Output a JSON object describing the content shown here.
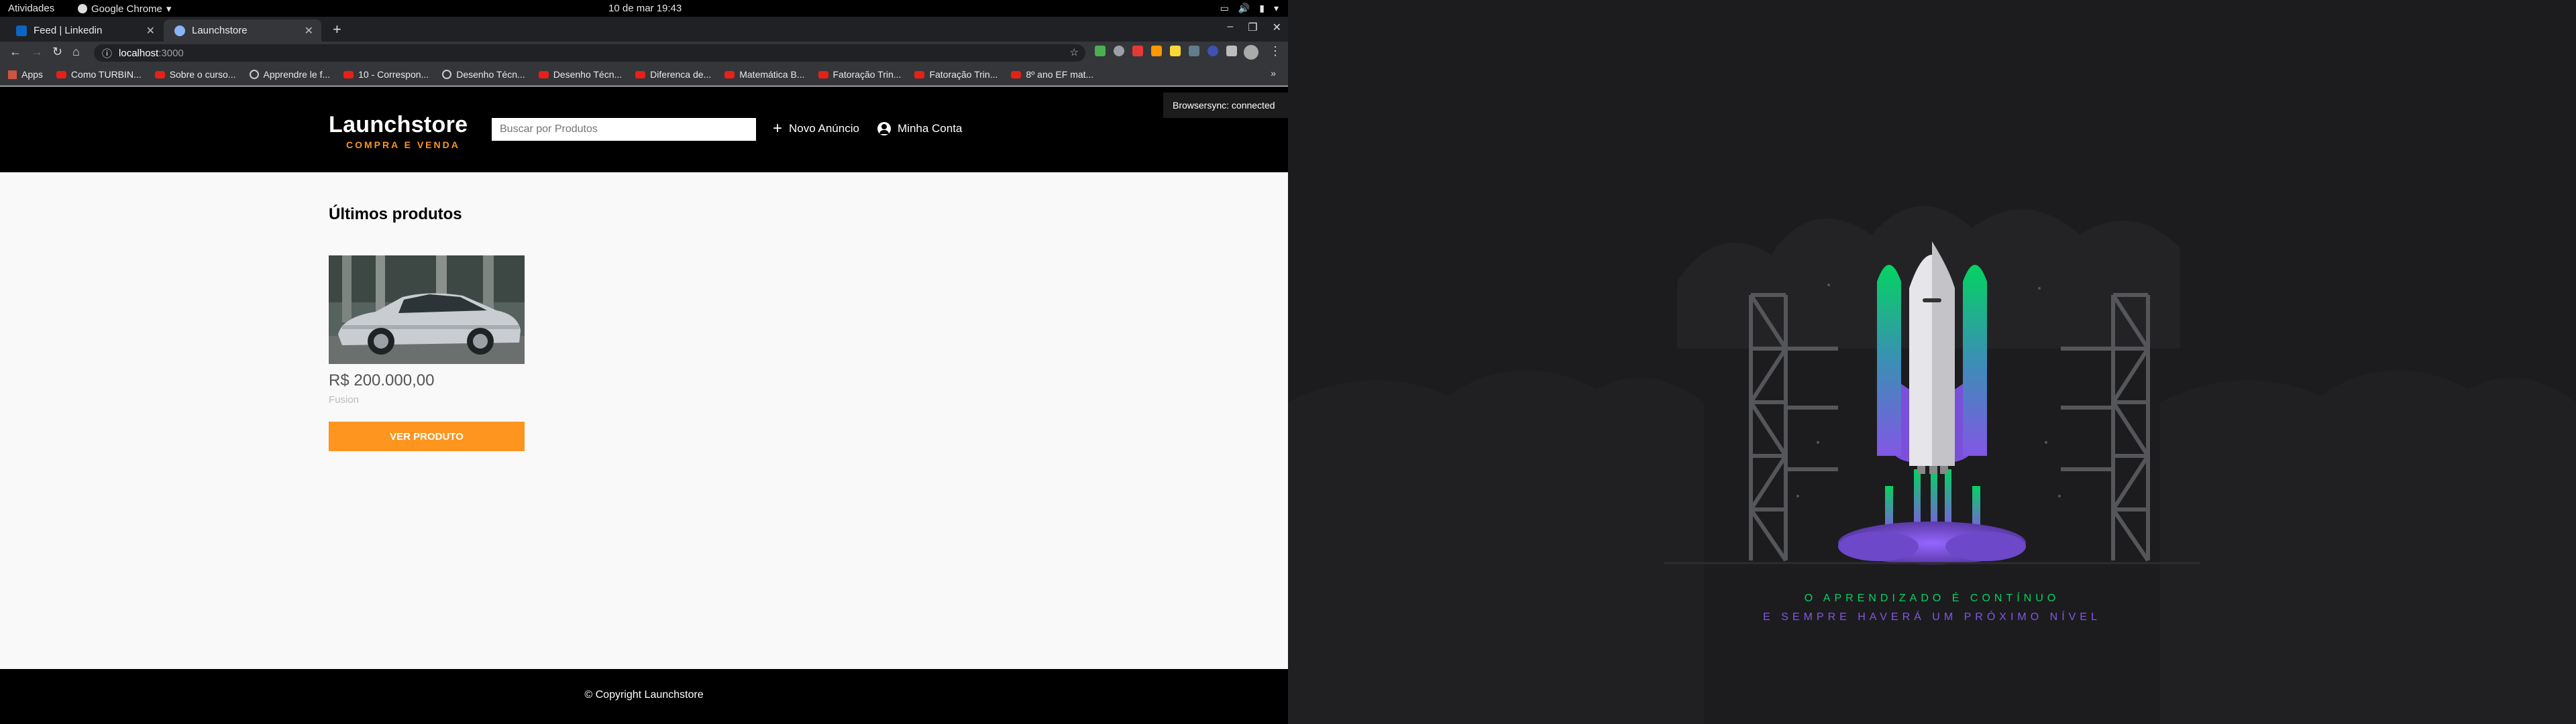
{
  "os_bar": {
    "activities": "Atividades",
    "app_name": "Google Chrome",
    "clock": "10 de mar  19:43"
  },
  "browser": {
    "tabs": [
      {
        "title": "Feed | Linkedin",
        "favicon_color": "#0a66c2"
      },
      {
        "title": "Launchstore",
        "favicon_color": "#8ab4f8"
      }
    ],
    "address": {
      "host": "localhost",
      "port": ":3000"
    },
    "bookmarks": [
      {
        "label": "Apps",
        "icon": "apps-grid-icon"
      },
      {
        "label": "Como TURBIN...",
        "icon": "youtube-icon"
      },
      {
        "label": "Sobre o curso...",
        "icon": "youtube-icon"
      },
      {
        "label": "Apprendre le f...",
        "icon": "globe-icon"
      },
      {
        "label": "10 - Correspon...",
        "icon": "youtube-icon"
      },
      {
        "label": "Desenho Técn...",
        "icon": "globe-icon"
      },
      {
        "label": "Desenho Técn...",
        "icon": "youtube-icon"
      },
      {
        "label": "Diferenca de...",
        "icon": "youtube-icon"
      },
      {
        "label": "Matemática B...",
        "icon": "youtube-icon"
      },
      {
        "label": "Fatoração Trin...",
        "icon": "youtube-icon"
      },
      {
        "label": "Fatoração Trin...",
        "icon": "youtube-icon"
      },
      {
        "label": "8º ano EF mat...",
        "icon": "youtube-icon"
      }
    ],
    "more": "»"
  },
  "site": {
    "logo_name": "Launchstore",
    "logo_tagline": "COMPRA E VENDA",
    "search_placeholder": "Buscar por Produtos",
    "nav_new": "Novo Anúncio",
    "nav_account": "Minha Conta",
    "browsersync": "Browsersync: connected",
    "section_title": "Últimos produtos",
    "product": {
      "price": "R$ 200.000,00",
      "model": "Fusion",
      "button": "VER PRODUTO"
    },
    "footer": "© Copyright Launchstore"
  },
  "wallpaper": {
    "line1": "O APRENDIZADO É CONTÍNUO",
    "line2": "E SEMPRE HAVERÁ UM PRÓXIMO NÍVEL"
  },
  "colors": {
    "accent_orange": "#fd951f",
    "tagline_green": "#04d361",
    "tagline_purple": "#8257e5"
  }
}
